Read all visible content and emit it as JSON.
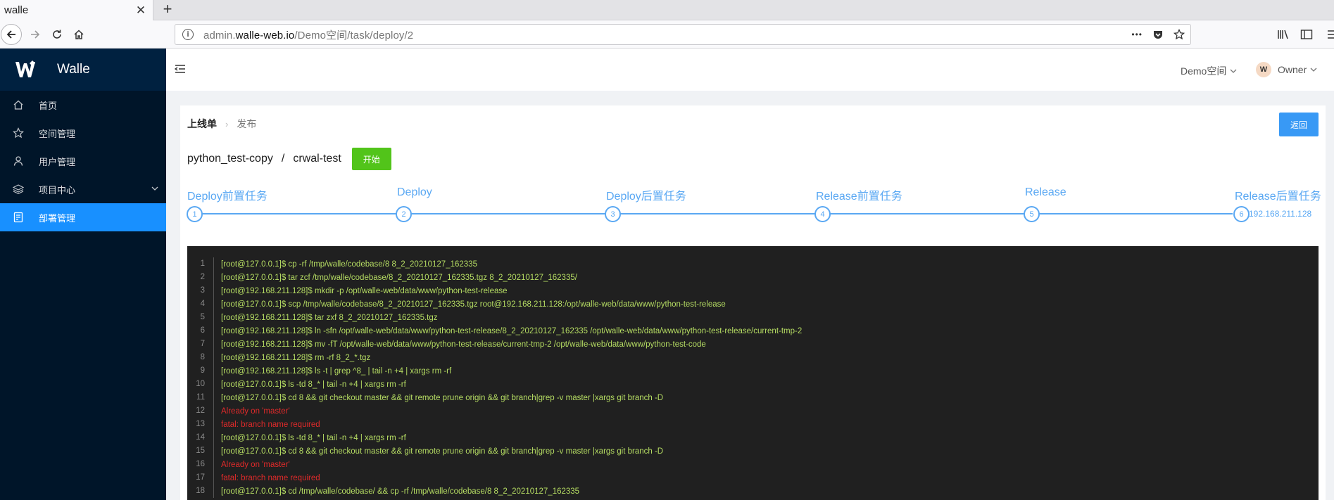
{
  "browser": {
    "tab_title": "walle",
    "tab_close": "✕",
    "new_tab": "+",
    "url_prefix": "admin.",
    "url_host": "walle-web.io",
    "url_path": "/Demo空间/task/deploy/2",
    "url_more": "•••"
  },
  "sidebar": {
    "brand": "Walle",
    "items": [
      {
        "label": "首页",
        "icon": "home-icon"
      },
      {
        "label": "空间管理",
        "icon": "star-icon"
      },
      {
        "label": "用户管理",
        "icon": "user-icon"
      },
      {
        "label": "项目中心",
        "icon": "layers-icon",
        "has_submenu": true
      },
      {
        "label": "部署管理",
        "icon": "deploy-icon",
        "active": true
      }
    ]
  },
  "header": {
    "space": "Demo空间",
    "user": "Owner",
    "avatar_letter": "W"
  },
  "breadcrumb": {
    "parent": "上线单",
    "current": "发布"
  },
  "back_button": "返回",
  "project": {
    "name": "python_test-copy",
    "separator": "/",
    "task": "crwal-test",
    "start_button": "开始"
  },
  "steps": [
    {
      "title": "Deploy前置任务",
      "num": "1"
    },
    {
      "title": "Deploy",
      "num": "2"
    },
    {
      "title": "Deploy后置任务",
      "num": "3"
    },
    {
      "title": "Release前置任务",
      "num": "4"
    },
    {
      "title": "Release",
      "num": "5"
    },
    {
      "title": "Release后置任务",
      "num": "6",
      "desc": "192.168.211.128"
    }
  ],
  "console": [
    {
      "n": "1",
      "text": "[root@127.0.0.1]$ cp -rf /tmp/walle/codebase/8 8_2_20210127_162335",
      "type": "out"
    },
    {
      "n": "2",
      "text": "[root@127.0.0.1]$ tar zcf /tmp/walle/codebase/8_2_20210127_162335.tgz 8_2_20210127_162335/",
      "type": "out"
    },
    {
      "n": "3",
      "text": "[root@192.168.211.128]$ mkdir -p /opt/walle-web/data/www/python-test-release",
      "type": "out"
    },
    {
      "n": "4",
      "text": "[root@127.0.0.1]$ scp /tmp/walle/codebase/8_2_20210127_162335.tgz root@192.168.211.128:/opt/walle-web/data/www/python-test-release",
      "type": "out"
    },
    {
      "n": "5",
      "text": "[root@192.168.211.128]$ tar zxf 8_2_20210127_162335.tgz",
      "type": "out"
    },
    {
      "n": "6",
      "text": "[root@192.168.211.128]$ ln -sfn /opt/walle-web/data/www/python-test-release/8_2_20210127_162335 /opt/walle-web/data/www/python-test-release/current-tmp-2",
      "type": "out"
    },
    {
      "n": "7",
      "text": "[root@192.168.211.128]$ mv -fT /opt/walle-web/data/www/python-test-release/current-tmp-2 /opt/walle-web/data/www/python-test-code",
      "type": "out"
    },
    {
      "n": "8",
      "text": "[root@192.168.211.128]$ rm -rf 8_2_*.tgz",
      "type": "out"
    },
    {
      "n": "9",
      "text": "[root@192.168.211.128]$ ls -t | grep ^8_ | tail -n +4 | xargs rm -rf",
      "type": "out"
    },
    {
      "n": "10",
      "text": "[root@127.0.0.1]$ ls -td 8_* | tail -n +4 | xargs rm -rf",
      "type": "out"
    },
    {
      "n": "11",
      "text": "[root@127.0.0.1]$ cd 8 && git checkout master && git remote prune origin && git branch|grep -v master |xargs git branch -D",
      "type": "out"
    },
    {
      "n": "12",
      "text": "Already on 'master'",
      "type": "err"
    },
    {
      "n": "13",
      "text": "fatal: branch name required",
      "type": "err"
    },
    {
      "n": "14",
      "text": "[root@127.0.0.1]$ ls -td 8_* | tail -n +4 | xargs rm -rf",
      "type": "out"
    },
    {
      "n": "15",
      "text": "[root@127.0.0.1]$ cd 8 && git checkout master && git remote prune origin && git branch|grep -v master |xargs git branch -D",
      "type": "out"
    },
    {
      "n": "16",
      "text": "Already on 'master'",
      "type": "err"
    },
    {
      "n": "17",
      "text": "fatal: branch name required",
      "type": "err"
    },
    {
      "n": "18",
      "text": "[root@127.0.0.1]$ cd /tmp/walle/codebase/ && cp -rf /tmp/walle/codebase/8 8_2_20210127_162335",
      "type": "out"
    }
  ],
  "colors": {
    "sidebar_bg": "#001529",
    "active_blue": "#1890ff",
    "step_blue": "#5aa8f3",
    "start_green": "#52c41a",
    "console_bg": "#202020",
    "console_out": "#b6dd63",
    "console_err": "#e12a2a"
  }
}
